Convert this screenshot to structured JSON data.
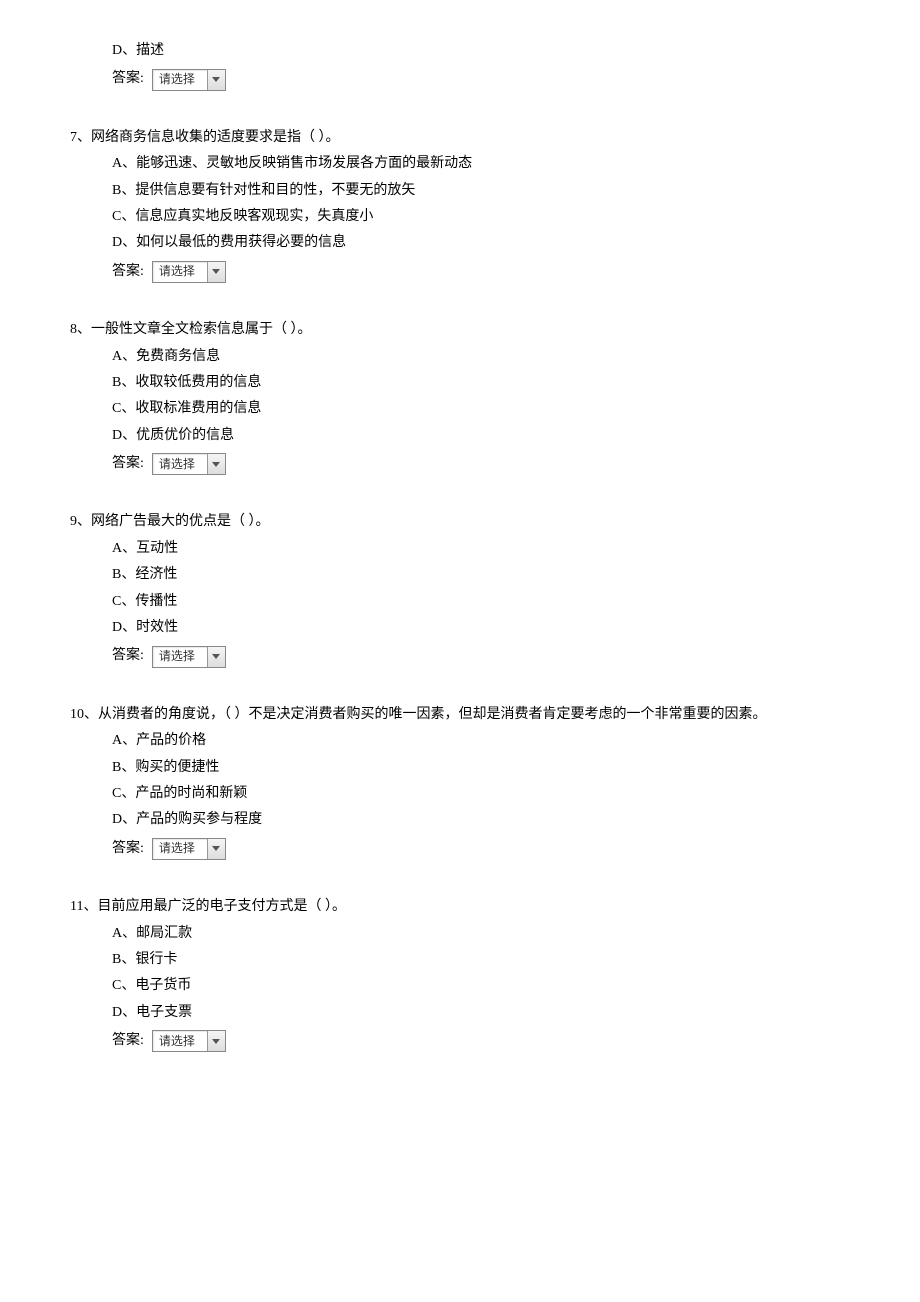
{
  "orphan": {
    "optionD": "D、描述",
    "answer_label": "答案:",
    "select_placeholder": "请选择"
  },
  "questions": [
    {
      "number": "7、",
      "text": "网络商务信息收集的适度要求是指（ ）。",
      "options": {
        "A": "A、能够迅速、灵敏地反映销售市场发展各方面的最新动态",
        "B": "B、提供信息要有针对性和目的性，不要无的放矢",
        "C": "C、信息应真实地反映客观现实，失真度小",
        "D": "D、如何以最低的费用获得必要的信息"
      },
      "answer_label": "答案:",
      "select_placeholder": "请选择"
    },
    {
      "number": "8、",
      "text": "一般性文章全文检索信息属于（ ）。",
      "options": {
        "A": "A、免费商务信息",
        "B": "B、收取较低费用的信息",
        "C": "C、收取标准费用的信息",
        "D": "D、优质优价的信息"
      },
      "answer_label": "答案:",
      "select_placeholder": "请选择"
    },
    {
      "number": "9、",
      "text": "网络广告最大的优点是（ ）。",
      "options": {
        "A": "A、互动性",
        "B": "B、经济性",
        "C": "C、传播性",
        "D": "D、时效性"
      },
      "answer_label": "答案:",
      "select_placeholder": "请选择"
    },
    {
      "number": "10、",
      "text": "从消费者的角度说，（ ）不是决定消费者购买的唯一因素，但却是消费者肯定要考虑的一个非常重要的因素。",
      "options": {
        "A": "A、产品的价格",
        "B": "B、购买的便捷性",
        "C": "C、产品的时尚和新颖",
        "D": "D、产品的购买参与程度"
      },
      "answer_label": "答案:",
      "select_placeholder": "请选择"
    },
    {
      "number": "11、",
      "text": "目前应用最广泛的电子支付方式是（ ）。",
      "options": {
        "A": "A、邮局汇款",
        "B": "B、银行卡",
        "C": "C、电子货币",
        "D": "D、电子支票"
      },
      "answer_label": "答案:",
      "select_placeholder": "请选择"
    }
  ]
}
